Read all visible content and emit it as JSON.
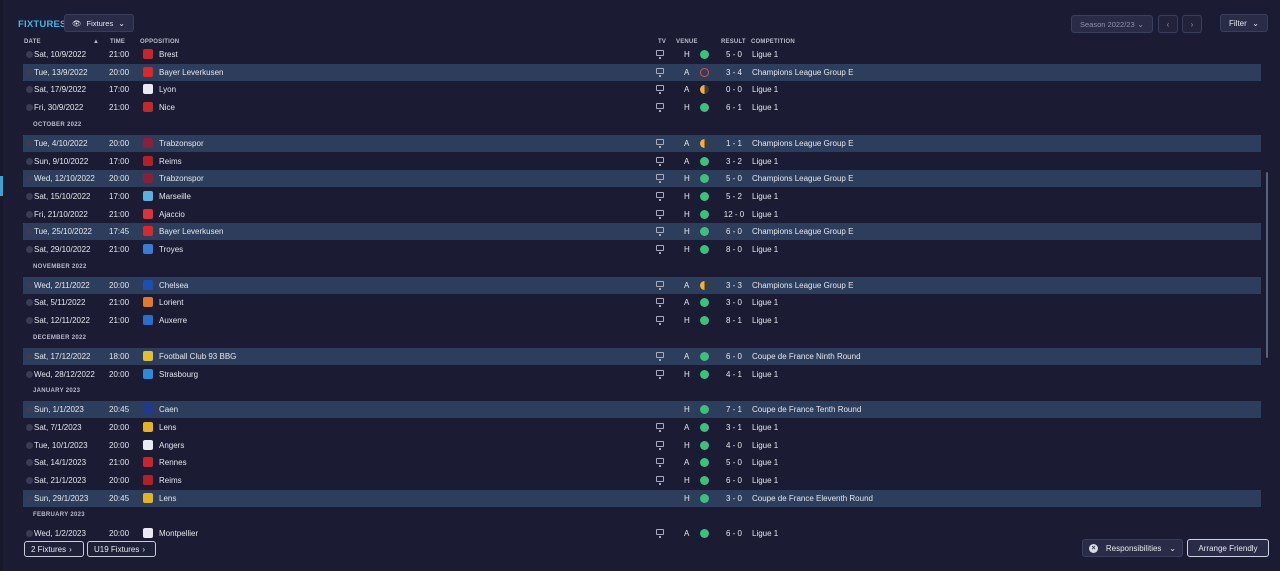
{
  "header": {
    "title": "FIXTURES",
    "view_button": "Fixtures",
    "season": "Season 2022/23",
    "filter": "Filter"
  },
  "columns": {
    "date": "DATE",
    "time": "TIME",
    "opposition": "OPPOSITION",
    "tv": "TV",
    "venue": "VENUE",
    "result": "RESULT",
    "competition": "COMPETITION"
  },
  "rows": [
    {
      "kind": "match",
      "date": "Sat, 10/9/2022",
      "time": "21:00",
      "opp": "Brest",
      "tv": true,
      "venue": "H",
      "result": "win",
      "score": "5 - 0",
      "comp": "Ligue 1",
      "crest": "#c8262f",
      "hl": false
    },
    {
      "kind": "match",
      "date": "Tue, 13/9/2022",
      "time": "20:00",
      "opp": "Bayer Leverkusen",
      "tv": true,
      "venue": "A",
      "result": "loss",
      "score": "3 - 4",
      "comp": "Champions League Group E",
      "crest": "#d62a2a",
      "hl": true
    },
    {
      "kind": "match",
      "date": "Sat, 17/9/2022",
      "time": "17:00",
      "opp": "Lyon",
      "tv": true,
      "venue": "A",
      "result": "draw",
      "score": "0 - 0",
      "comp": "Ligue 1",
      "crest": "#e9e9f2",
      "hl": false
    },
    {
      "kind": "match",
      "date": "Fri, 30/9/2022",
      "time": "21:00",
      "opp": "Nice",
      "tv": true,
      "venue": "H",
      "result": "win",
      "score": "6 - 1",
      "comp": "Ligue 1",
      "crest": "#c22a2a",
      "hl": false
    },
    {
      "kind": "month",
      "label": "OCTOBER 2022"
    },
    {
      "kind": "match",
      "date": "Tue, 4/10/2022",
      "time": "20:00",
      "opp": "Trabzonspor",
      "tv": true,
      "venue": "A",
      "result": "draw",
      "score": "1 - 1",
      "comp": "Champions League Group E",
      "crest": "#8a1f3a",
      "hl": true
    },
    {
      "kind": "match",
      "date": "Sun, 9/10/2022",
      "time": "17:00",
      "opp": "Reims",
      "tv": true,
      "venue": "A",
      "result": "win",
      "score": "3 - 2",
      "comp": "Ligue 1",
      "crest": "#b32027",
      "hl": false
    },
    {
      "kind": "match",
      "date": "Wed, 12/10/2022",
      "time": "20:00",
      "opp": "Trabzonspor",
      "tv": true,
      "venue": "H",
      "result": "win",
      "score": "5 - 0",
      "comp": "Champions League Group E",
      "crest": "#8a1f3a",
      "hl": true
    },
    {
      "kind": "match",
      "date": "Sat, 15/10/2022",
      "time": "17:00",
      "opp": "Marseille",
      "tv": true,
      "venue": "H",
      "result": "win",
      "score": "5 - 2",
      "comp": "Ligue 1",
      "crest": "#5bb0e0",
      "hl": false
    },
    {
      "kind": "match",
      "date": "Fri, 21/10/2022",
      "time": "21:00",
      "opp": "Ajaccio",
      "tv": true,
      "venue": "H",
      "result": "win",
      "score": "12 - 0",
      "comp": "Ligue 1",
      "crest": "#d9343a",
      "hl": false
    },
    {
      "kind": "match",
      "date": "Tue, 25/10/2022",
      "time": "17:45",
      "opp": "Bayer Leverkusen",
      "tv": true,
      "venue": "H",
      "result": "win",
      "score": "6 - 0",
      "comp": "Champions League Group E",
      "crest": "#d62a2a",
      "hl": true
    },
    {
      "kind": "match",
      "date": "Sat, 29/10/2022",
      "time": "21:00",
      "opp": "Troyes",
      "tv": true,
      "venue": "H",
      "result": "win",
      "score": "8 - 0",
      "comp": "Ligue 1",
      "crest": "#3a7bd5",
      "hl": false
    },
    {
      "kind": "month",
      "label": "NOVEMBER 2022"
    },
    {
      "kind": "match",
      "date": "Wed, 2/11/2022",
      "time": "20:00",
      "opp": "Chelsea",
      "tv": true,
      "venue": "A",
      "result": "draw",
      "score": "3 - 3",
      "comp": "Champions League Group E",
      "crest": "#1c4fb0",
      "hl": true
    },
    {
      "kind": "match",
      "date": "Sat, 5/11/2022",
      "time": "21:00",
      "opp": "Lorient",
      "tv": true,
      "venue": "A",
      "result": "win",
      "score": "3 - 0",
      "comp": "Ligue 1",
      "crest": "#e07a2a",
      "hl": false
    },
    {
      "kind": "match",
      "date": "Sat, 12/11/2022",
      "time": "21:00",
      "opp": "Auxerre",
      "tv": true,
      "venue": "H",
      "result": "win",
      "score": "8 - 1",
      "comp": "Ligue 1",
      "crest": "#2a6fc9",
      "hl": false
    },
    {
      "kind": "month",
      "label": "DECEMBER 2022"
    },
    {
      "kind": "match",
      "date": "Sat, 17/12/2022",
      "time": "18:00",
      "opp": "Football Club 93 BBG",
      "tv": true,
      "venue": "A",
      "result": "win",
      "score": "6 - 0",
      "comp": "Coupe de France Ninth Round",
      "crest": "#e0c030",
      "hl": true
    },
    {
      "kind": "match",
      "date": "Wed, 28/12/2022",
      "time": "20:00",
      "opp": "Strasbourg",
      "tv": true,
      "venue": "H",
      "result": "win",
      "score": "4 - 1",
      "comp": "Ligue 1",
      "crest": "#2d8ad8",
      "hl": false
    },
    {
      "kind": "month",
      "label": "JANUARY 2023"
    },
    {
      "kind": "match",
      "date": "Sun, 1/1/2023",
      "time": "20:45",
      "opp": "Caen",
      "tv": false,
      "venue": "H",
      "result": "win",
      "score": "7 - 1",
      "comp": "Coupe de France Tenth Round",
      "crest": "#1f3a8f",
      "hl": true
    },
    {
      "kind": "match",
      "date": "Sat, 7/1/2023",
      "time": "20:00",
      "opp": "Lens",
      "tv": true,
      "venue": "A",
      "result": "win",
      "score": "3 - 1",
      "comp": "Ligue 1",
      "crest": "#e3b322",
      "hl": false
    },
    {
      "kind": "match",
      "date": "Tue, 10/1/2023",
      "time": "20:00",
      "opp": "Angers",
      "tv": true,
      "venue": "H",
      "result": "win",
      "score": "4 - 0",
      "comp": "Ligue 1",
      "crest": "#e9e9f2",
      "hl": false
    },
    {
      "kind": "match",
      "date": "Sat, 14/1/2023",
      "time": "21:00",
      "opp": "Rennes",
      "tv": true,
      "venue": "A",
      "result": "win",
      "score": "5 - 0",
      "comp": "Ligue 1",
      "crest": "#c8262f",
      "hl": false
    },
    {
      "kind": "match",
      "date": "Sat, 21/1/2023",
      "time": "20:00",
      "opp": "Reims",
      "tv": true,
      "venue": "H",
      "result": "win",
      "score": "6 - 0",
      "comp": "Ligue 1",
      "crest": "#b32027",
      "hl": false
    },
    {
      "kind": "match",
      "date": "Sun, 29/1/2023",
      "time": "20:45",
      "opp": "Lens",
      "tv": false,
      "venue": "H",
      "result": "win",
      "score": "3 - 0",
      "comp": "Coupe de France Eleventh Round",
      "crest": "#e3b322",
      "hl": true
    },
    {
      "kind": "month",
      "label": "FEBRUARY 2023"
    },
    {
      "kind": "match",
      "date": "Wed, 1/2/2023",
      "time": "20:00",
      "opp": "Montpellier",
      "tv": true,
      "venue": "A",
      "result": "win",
      "score": "6 - 0",
      "comp": "Ligue 1",
      "crest": "#e9e9f2",
      "hl": false
    }
  ],
  "footer": {
    "btn_fixtures": "2 Fixtures",
    "btn_u19": "U19 Fixtures",
    "responsibilities": "Responsibilities",
    "arrange": "Arrange Friendly"
  }
}
